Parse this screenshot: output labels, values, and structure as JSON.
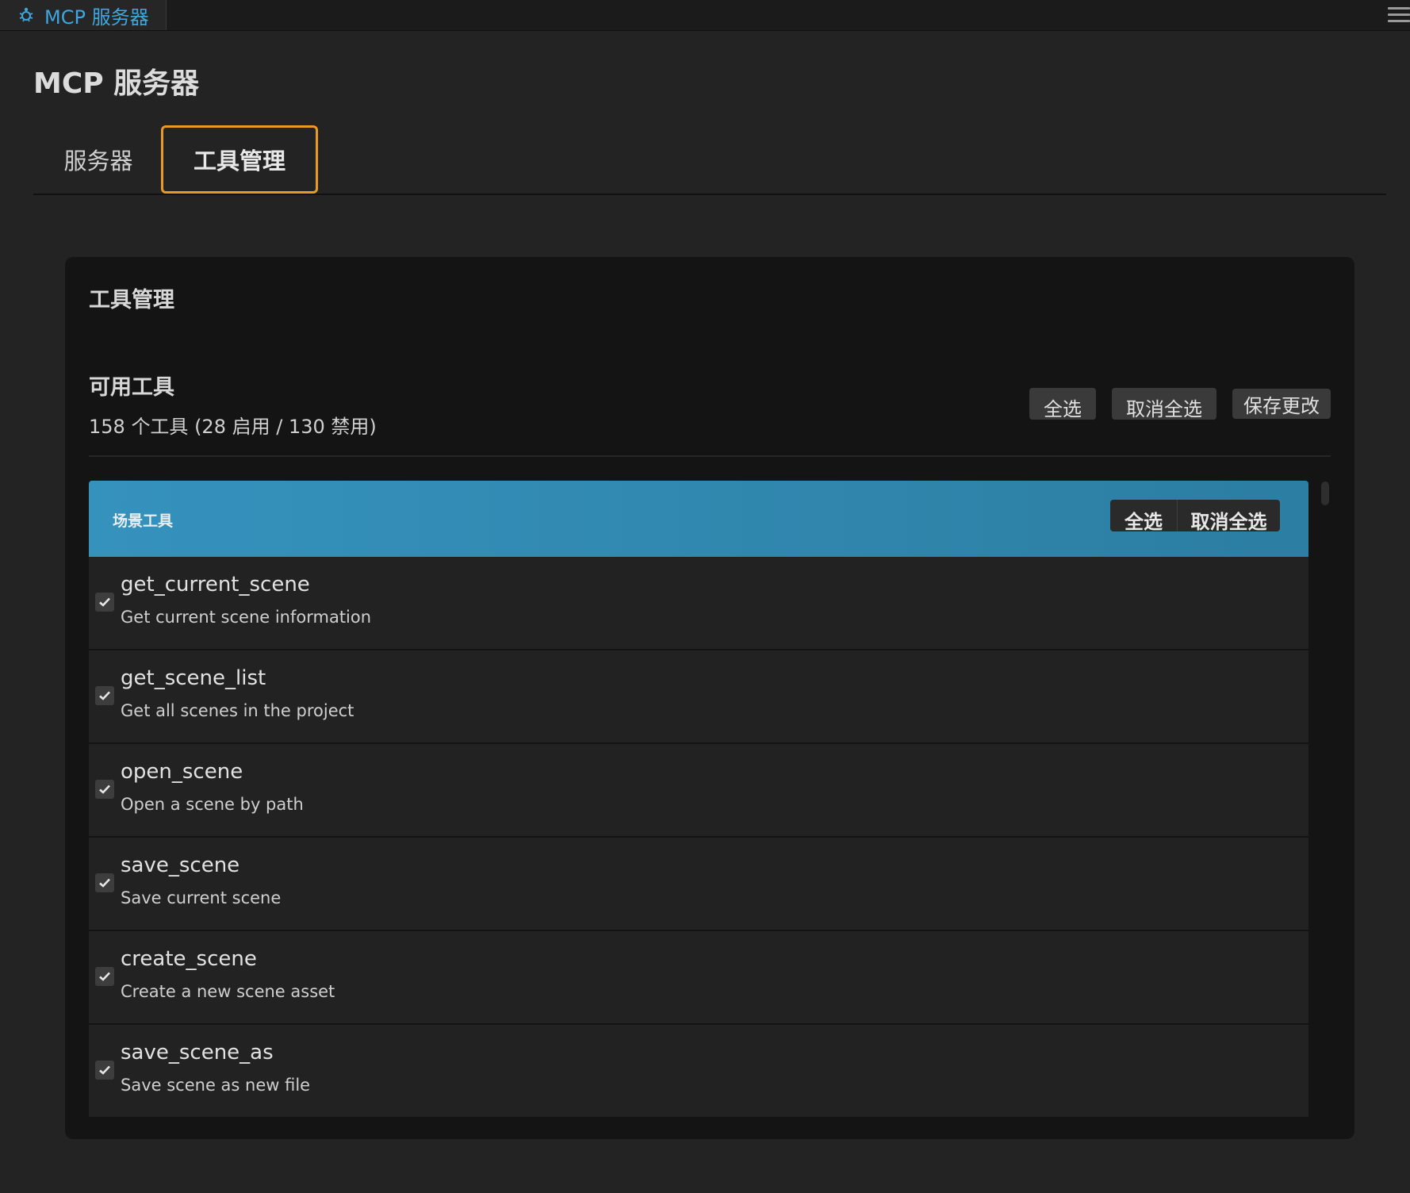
{
  "window": {
    "title": "MCP 服务器",
    "icon": "gear-bug-icon"
  },
  "header": {
    "page_title": "MCP 服务器"
  },
  "tabs": [
    {
      "label": "服务器",
      "active": false
    },
    {
      "label": "工具管理",
      "active": true
    }
  ],
  "panel": {
    "title": "工具管理",
    "available_title": "可用工具",
    "count_text": "158 个工具 (28 启用 / 130 禁用)",
    "select_all_label": "全选",
    "deselect_all_label": "取消全选",
    "save_label": "保存更改"
  },
  "group": {
    "title": "场景工具",
    "select_all_label": "全选",
    "deselect_all_label": "取消全选",
    "header_color": "#3592bd",
    "tools": [
      {
        "name": "get_current_scene",
        "description": "Get current scene information",
        "enabled": true
      },
      {
        "name": "get_scene_list",
        "description": "Get all scenes in the project",
        "enabled": true
      },
      {
        "name": "open_scene",
        "description": "Open a scene by path",
        "enabled": true
      },
      {
        "name": "save_scene",
        "description": "Save current scene",
        "enabled": true
      },
      {
        "name": "create_scene",
        "description": "Create a new scene asset",
        "enabled": true
      },
      {
        "name": "save_scene_as",
        "description": "Save scene as new file",
        "enabled": true
      }
    ]
  },
  "colors": {
    "accent_tab_border": "#e79b24",
    "title_blue": "#3ea7e0"
  }
}
